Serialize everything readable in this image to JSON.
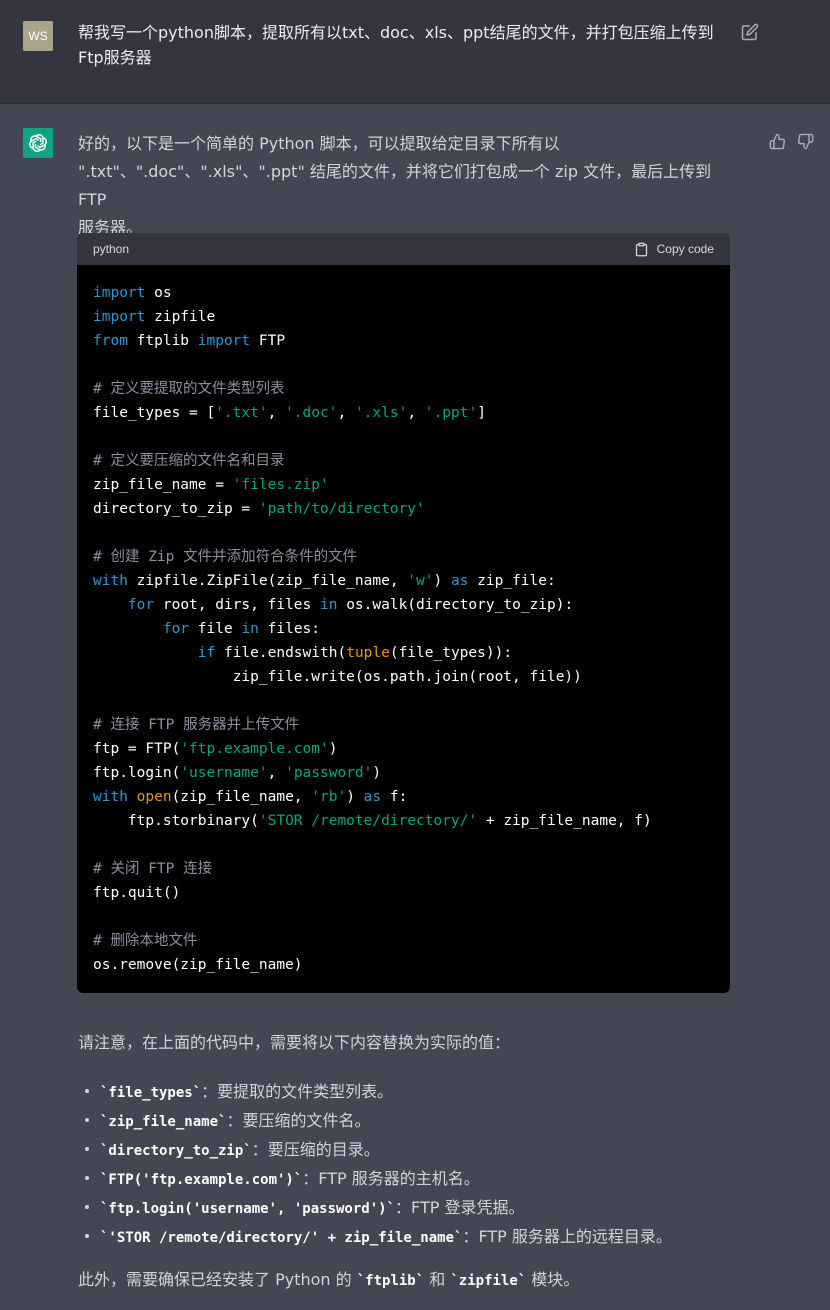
{
  "user": {
    "avatar_initials": "WS",
    "message": "帮我写一个python脚本，提取所有以txt、doc、xls、ppt结尾的文件，并打包压缩上传到Ftp服务器"
  },
  "assistant": {
    "intro_line1": "好的，以下是一个简单的 Python 脚本，可以提取给定目录下所有以",
    "intro_line2": "\".txt\"、\".doc\"、\".xls\"、\".ppt\" 结尾的文件，并将它们打包成一个 zip 文件，最后上传到 FTP",
    "intro_line3": "服务器。",
    "code": {
      "language": "python",
      "copy_label": "Copy code"
    },
    "note": "请注意，在上面的代码中，需要将以下内容替换为实际的值：",
    "bullets": [
      {
        "code": "`file_types`",
        "text": "：要提取的文件类型列表。"
      },
      {
        "code": "`zip_file_name`",
        "text": "：要压缩的文件名。"
      },
      {
        "code": "`directory_to_zip`",
        "text": "：要压缩的目录。"
      },
      {
        "code": "`FTP('ftp.example.com')`",
        "text": "：FTP 服务器的主机名。"
      },
      {
        "code": "`ftp.login('username', 'password')`",
        "text": "：FTP 登录凭据。"
      },
      {
        "code": "`'STOR /remote/directory/' + zip_file_name`",
        "text": "：FTP 服务器上的远程目录。"
      }
    ],
    "outro_prefix": "此外，需要确保已经安装了 Python 的 ",
    "outro_code1": "`ftplib`",
    "outro_mid": " 和 ",
    "outro_code2": "`zipfile`",
    "outro_suffix": " 模块。"
  },
  "code_tokens": {
    "import": "import",
    "from": "from",
    "with": "with",
    "as": "as",
    "for": "for",
    "in": "in",
    "if": "if",
    "tuple": "tuple",
    "open": "open",
    "os": " os",
    "zipfile": " zipfile",
    "ftplib": " ftplib ",
    "ftp_cls": " FTP",
    "c1": "# 定义要提取的文件类型列表",
    "l5a": "file_types = [",
    "s_txt": "'.txt'",
    "s_doc": "'.doc'",
    "s_xls": "'.xls'",
    "s_ppt": "'.ppt'",
    "comma": ", ",
    "rb_close": "]",
    "c2": "# 定义要压缩的文件名和目录",
    "l8a": "zip_file_name = ",
    "s_files_zip": "'files.zip'",
    "l9a": "directory_to_zip = ",
    "s_path": "'path/to/directory'",
    "c3": "# 创建 Zip 文件并添加符合条件的文件",
    "l12a": " zipfile.ZipFile(zip_file_name, ",
    "s_w": "'w'",
    "l12b": ") ",
    "l12c": " zip_file:",
    "ind4": "    ",
    "ind8": "        ",
    "ind12": "            ",
    "ind16": "                ",
    "l13a": " root, dirs, files ",
    "l13b": " os.walk(directory_to_zip):",
    "l14a": " file ",
    "l14b": " files:",
    "l15a": " file.endswith(",
    "l15b": "(file_types)):",
    "l16": "zip_file.write(os.path.join(root, file))",
    "c4": "# 连接 FTP 服务器并上传文件",
    "l19a": "ftp = FTP(",
    "s_host": "'ftp.example.com'",
    "paren": ")",
    "l20a": "ftp.login(",
    "s_user": "'username'",
    "s_pass": "'password'",
    "l21a": "(zip_file_name, ",
    "s_rb": "'rb'",
    "l21c": " f:",
    "l22a": "ftp.storbinary(",
    "s_stor": "'STOR /remote/directory/'",
    "l22b": " + zip_file_name, f)",
    "c5": "# 关闭 FTP 连接",
    "l25": "ftp.quit()",
    "c6": "# 删除本地文件",
    "l28": "os.remove(zip_file_name)"
  }
}
